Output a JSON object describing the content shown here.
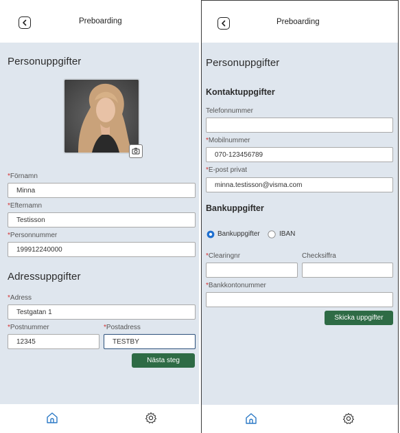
{
  "left": {
    "header": {
      "title": "Preboarding"
    },
    "section_personal": "Personuppgifter",
    "photo": {
      "icon": "camera-icon"
    },
    "fields": {
      "first_name": {
        "label": "Förnamn",
        "value": "Minna"
      },
      "last_name": {
        "label": "Efternamn",
        "value": "Testisson"
      },
      "personal_number": {
        "label": "Personnummer",
        "value": "199912240000"
      }
    },
    "section_address": "Adressuppgifter",
    "address": {
      "street": {
        "label": "Adress",
        "value": "Testgatan 1"
      },
      "postal_code": {
        "label": "Postnummer",
        "value": "12345"
      },
      "city": {
        "label": "Postadress",
        "value": "TESTBY"
      }
    },
    "next_button": "Nästa steg",
    "footer": {
      "home_icon": "home-icon",
      "settings_icon": "gear-icon"
    }
  },
  "right": {
    "header": {
      "title": "Preboarding"
    },
    "section_personal": "Personuppgifter",
    "contact_title": "Kontaktuppgifter",
    "contact": {
      "phone": {
        "label": "Telefonnummer",
        "value": ""
      },
      "mobile": {
        "label": "Mobilnummer",
        "value": "070-123456789"
      },
      "email": {
        "label": "E-post privat",
        "value": "minna.testisson@visma.com"
      }
    },
    "bank_title": "Bankuppgifter",
    "bank_options": {
      "selected": "Bankuppgifter",
      "other": "IBAN"
    },
    "bank": {
      "clearing": {
        "label": "Clearingnr",
        "value": ""
      },
      "check_digit": {
        "label": "Checksiffra",
        "value": ""
      },
      "account": {
        "label": "Bankkontonummer",
        "value": ""
      }
    },
    "submit_button": "Skicka uppgifter",
    "footer": {
      "home_icon": "home-icon",
      "settings_icon": "gear-icon"
    }
  },
  "colors": {
    "accent_green": "#2e6b45",
    "body_bg": "#dfe6ee",
    "required": "#d32f2f",
    "radio_blue": "#1e6fd0"
  }
}
